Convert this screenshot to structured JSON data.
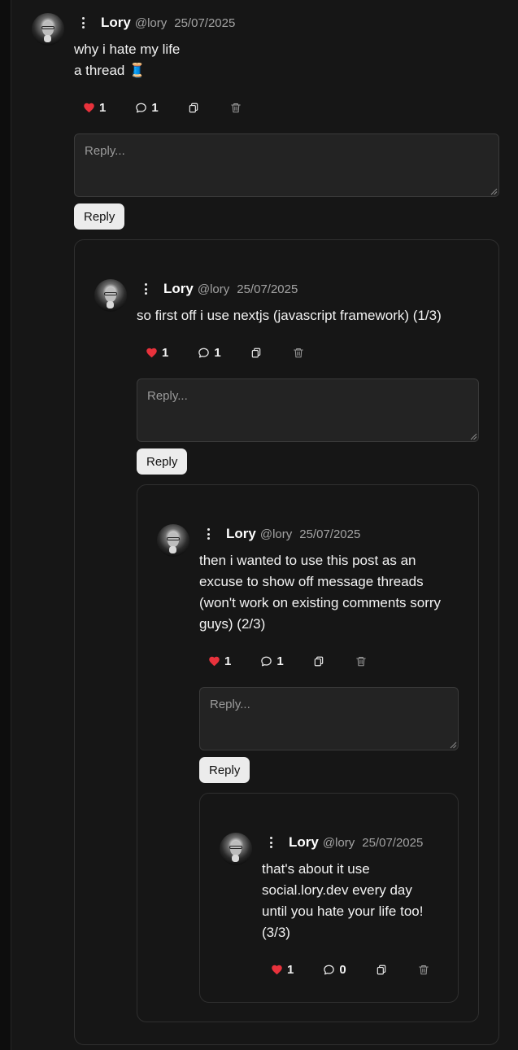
{
  "comments": [
    {
      "author": "Lory",
      "handle": "@lory",
      "date": "25/07/2025",
      "lines": [
        "why i hate my life",
        "a thread 🧵"
      ],
      "likes": "1",
      "replies": "1",
      "reply_placeholder": "Reply...",
      "reply_button": "Reply"
    },
    {
      "author": "Lory",
      "handle": "@lory",
      "date": "25/07/2025",
      "lines": [
        "so first off i use nextjs (javascript framework) (1/3)"
      ],
      "likes": "1",
      "replies": "1",
      "reply_placeholder": "Reply...",
      "reply_button": "Reply"
    },
    {
      "author": "Lory",
      "handle": "@lory",
      "date": "25/07/2025",
      "lines": [
        "then i wanted to use this post as an",
        "excuse to show off message threads",
        "(won't work on existing comments sorry",
        "guys) (2/3)"
      ],
      "likes": "1",
      "replies": "1",
      "reply_placeholder": "Reply...",
      "reply_button": "Reply"
    },
    {
      "author": "Lory",
      "handle": "@lory",
      "date": "25/07/2025",
      "lines": [
        "that's about it use",
        "social.lory.dev every day",
        "until you hate your life too!",
        "(3/3)"
      ],
      "likes": "1",
      "replies": "0"
    }
  ],
  "colors": {
    "heart": "#e8323c",
    "background": "#0d0d0d",
    "panel": "#161616"
  },
  "icons": {
    "like": "heart-icon",
    "reply": "speech-bubble-icon",
    "copy": "copy-icon",
    "delete": "trash-icon",
    "menu": "kebab-menu-icon"
  }
}
